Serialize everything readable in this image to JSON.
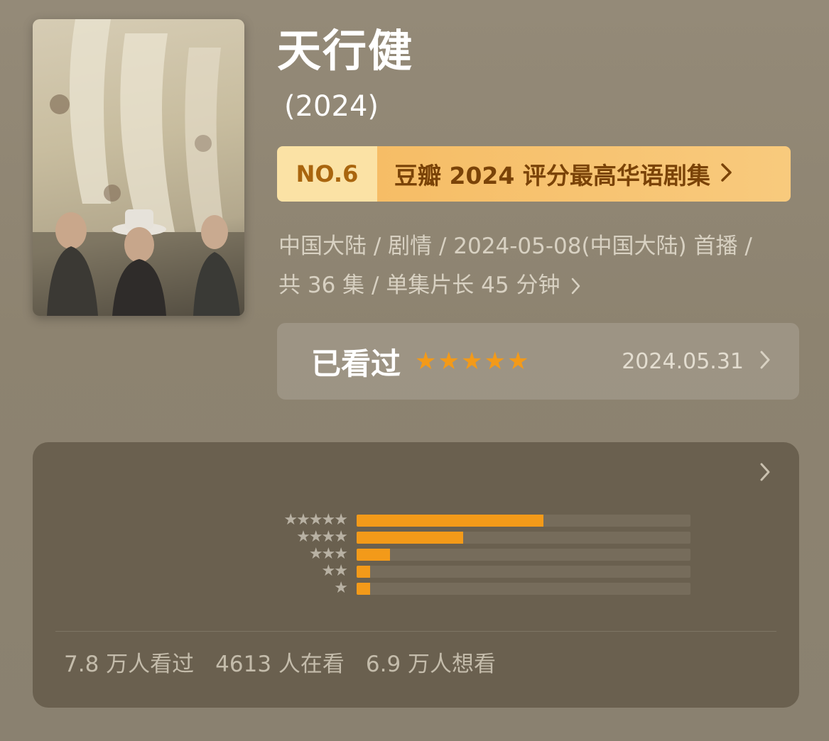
{
  "title": "天行健",
  "year": "(2024)",
  "ranking": {
    "number": "NO.6",
    "text": "豆瓣 2024 评分最高华语剧集"
  },
  "meta": {
    "line1": "中国大陆 / 剧情 / 2024-05-08(中国大陆) 首播 /",
    "line2": "共 36 集 / 单集片长 45 分钟"
  },
  "my_rating": {
    "status": "已看过",
    "stars": 5,
    "date": "2024.05.31"
  },
  "rating_distribution": [
    {
      "stars": "★★★★★",
      "share": 0.56
    },
    {
      "stars": "★★★★",
      "share": 0.32
    },
    {
      "stars": "★★★",
      "share": 0.1
    },
    {
      "stars": "★★",
      "share": 0.04
    },
    {
      "stars": "★",
      "share": 0.04
    }
  ],
  "counts": {
    "watched": "7.8 万人看过",
    "watching": "4613 人在看",
    "want": "6.9 万人想看"
  },
  "colors": {
    "accent": "#f39a19",
    "rank_left_bg": "#fbe2a5",
    "rank_right_bg": "#f6bd66"
  }
}
